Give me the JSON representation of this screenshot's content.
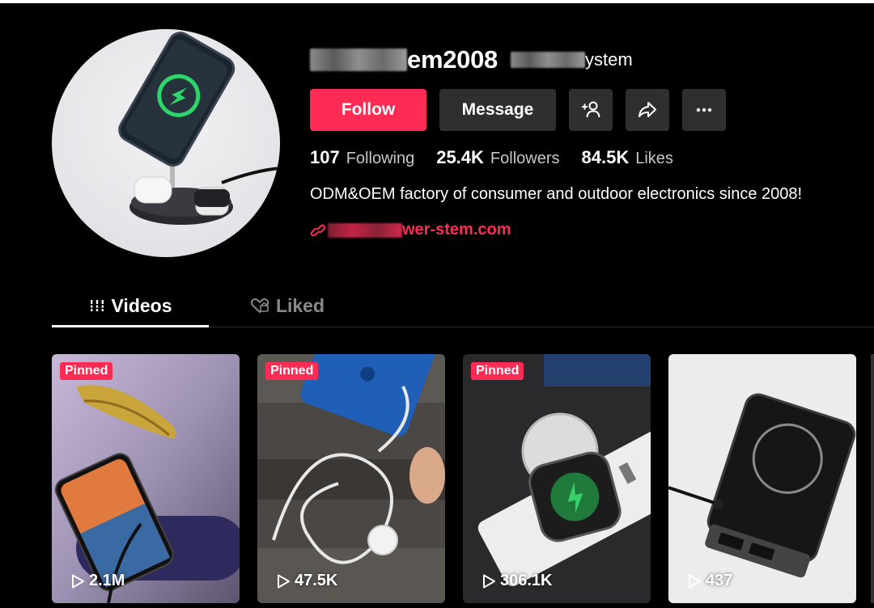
{
  "profile": {
    "username_visible": "em2008",
    "nickname_visible": "ystem",
    "bio": "ODM&OEM factory of consumer and outdoor electronics since 2008!",
    "link_visible": "wer-stem.com"
  },
  "actions": {
    "follow_label": "Follow",
    "message_label": "Message",
    "add_friend_icon": "add-user-icon",
    "share_icon": "share-icon",
    "more_icon": "more-icon"
  },
  "stats": [
    {
      "value": "107",
      "label": "Following"
    },
    {
      "value": "25.4K",
      "label": "Followers"
    },
    {
      "value": "84.5K",
      "label": "Likes"
    }
  ],
  "tabs": [
    {
      "label": "Videos",
      "active": true,
      "icon": "grid-icon"
    },
    {
      "label": "Liked",
      "active": false,
      "icon": "heart-lock-icon"
    }
  ],
  "videos": [
    {
      "pinned": "Pinned",
      "views": "2.1M"
    },
    {
      "pinned": "Pinned",
      "views": "47.5K"
    },
    {
      "pinned": "Pinned",
      "views": "306.1K"
    },
    {
      "pinned": "",
      "views": "437"
    }
  ],
  "colors": {
    "accent": "#fe2c55",
    "background": "#000000",
    "button_secondary": "#2f2f2f",
    "muted_text": "#c7c7c7"
  }
}
